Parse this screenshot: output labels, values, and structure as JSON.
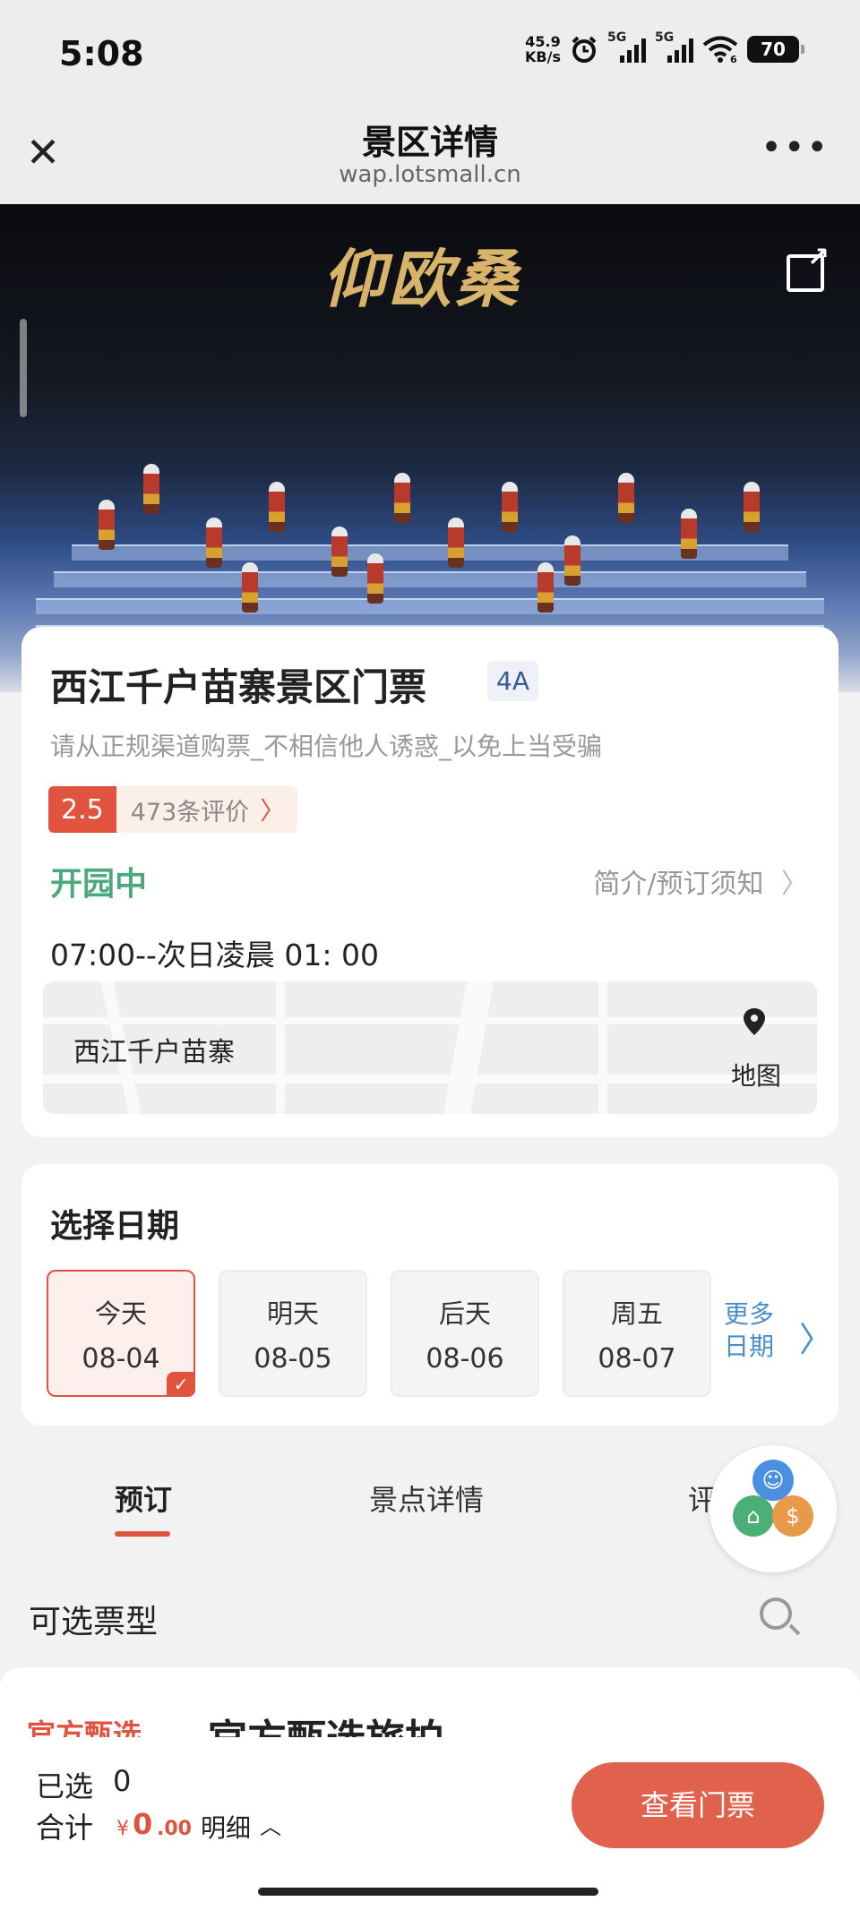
{
  "status_bar": {
    "time": "5:08",
    "net_speed_value": "45.9",
    "net_speed_unit": "KB/s",
    "sim1": "5G",
    "sim2": "5G",
    "wifi_label": "6",
    "battery": "70"
  },
  "nav": {
    "title": "景区详情",
    "url": "wap.lotsmall.cn",
    "close_icon": "close-icon",
    "more_icon": "more-dots-icon"
  },
  "hero": {
    "title_art": "仰欧桑",
    "share_icon": "share-icon"
  },
  "scenic": {
    "name": "西江千户苗寨景区门票",
    "grade": "4A",
    "notice": "请从正规渠道购票_不相信他人诱惑_以免上当受骗",
    "rating_score": "2.5",
    "review_count": "473条评价",
    "open_status": "开园中",
    "intro_link": "简介/预订须知",
    "hours": "07:00--次日凌晨 01: 00",
    "place": "西江千户苗寨",
    "map_label": "地图"
  },
  "date_select": {
    "title": "选择日期",
    "dates": [
      {
        "day": "今天",
        "date": "08-04",
        "selected": true
      },
      {
        "day": "明天",
        "date": "08-05",
        "selected": false
      },
      {
        "day": "后天",
        "date": "08-06",
        "selected": false
      },
      {
        "day": "周五",
        "date": "08-07",
        "selected": false
      }
    ],
    "more_line1": "更多",
    "more_line2": "日期"
  },
  "tabs": [
    {
      "label": "预订",
      "active": true
    },
    {
      "label": "景点详情",
      "active": false
    },
    {
      "label": "评价",
      "active": false
    }
  ],
  "tickets": {
    "section_title": "可选票型",
    "first_tag": "官方甄选",
    "first_name": "官方甄选旅拍"
  },
  "bottom_bar": {
    "selected_label": "已选",
    "selected_count": "0",
    "total_label": "合计",
    "currency": "¥",
    "amount_int": "0",
    "amount_dec": ".00",
    "detail_label": "明细",
    "cta_label": "查看门票"
  },
  "colors": {
    "accent": "#e0533f",
    "open_green": "#4ca97e",
    "link_blue": "#4a90c8"
  }
}
